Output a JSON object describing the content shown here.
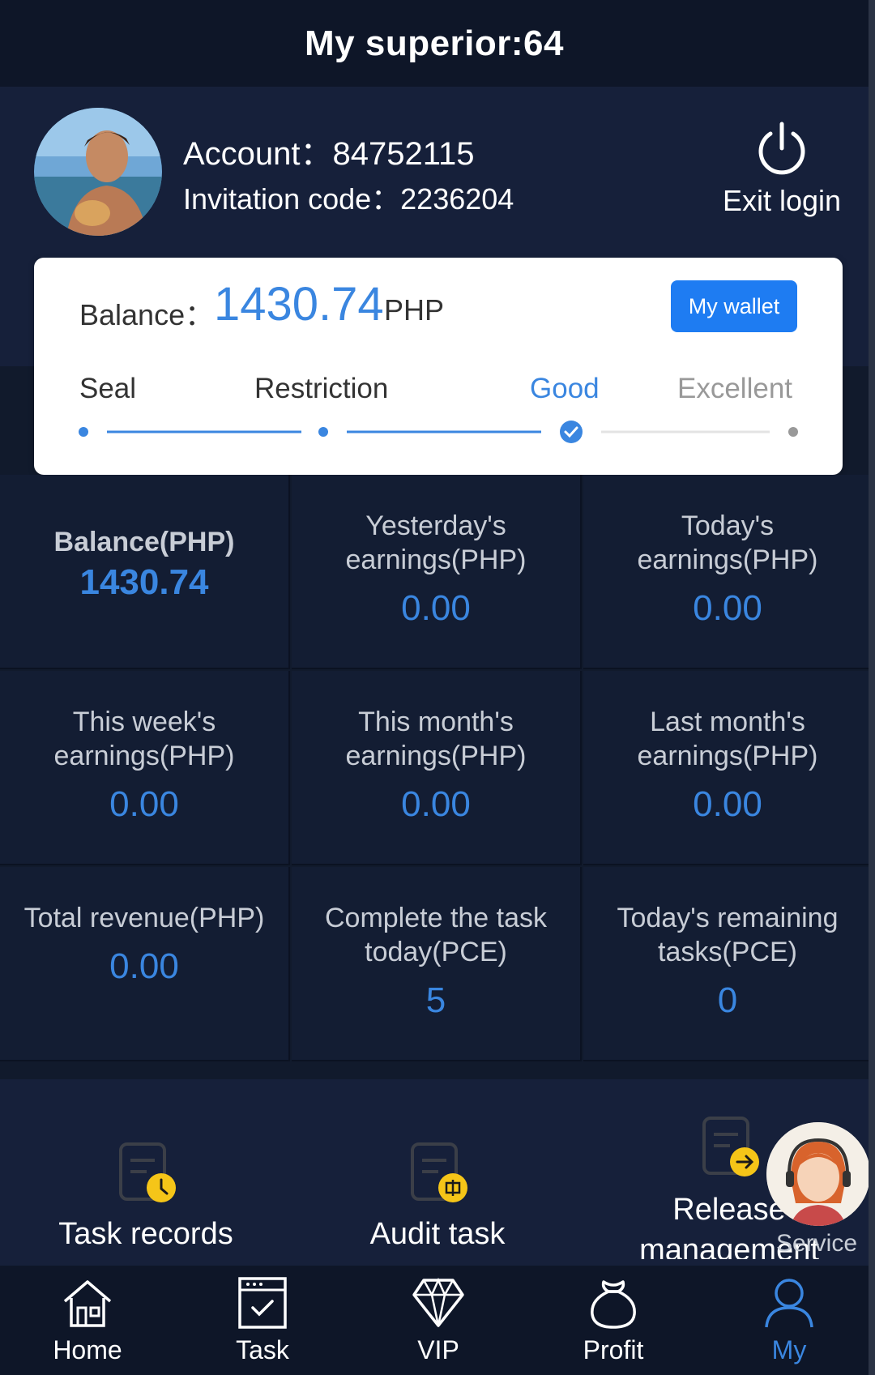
{
  "header": {
    "title": "My superior:64"
  },
  "profile": {
    "account_label": "Account：84752115",
    "invitation_label": "Invitation code：2236204",
    "exit_label": "Exit login"
  },
  "balance_card": {
    "label": "Balance：",
    "value": "1430.74",
    "unit": "PHP",
    "wallet_button": "My wallet",
    "levels": [
      "Seal",
      "Restriction",
      "Good",
      "Excellent"
    ],
    "current_level": "Good"
  },
  "stats": [
    {
      "label": "Balance(PHP)",
      "value": "1430.74"
    },
    {
      "label": "Yesterday's earnings(PHP)",
      "value": "0.00"
    },
    {
      "label": "Today's earnings(PHP)",
      "value": "0.00"
    },
    {
      "label": "This week's earnings(PHP)",
      "value": "0.00"
    },
    {
      "label": "This month's earnings(PHP)",
      "value": "0.00"
    },
    {
      "label": "Last month's earnings(PHP)",
      "value": "0.00"
    },
    {
      "label": "Total revenue(PHP)",
      "value": "0.00"
    },
    {
      "label": "Complete the task today(PCE)",
      "value": "5"
    },
    {
      "label": "Today's remaining tasks(PCE)",
      "value": "0"
    }
  ],
  "actions": [
    {
      "label": "Task records",
      "icon": "task-records-icon"
    },
    {
      "label": "Audit task",
      "icon": "audit-task-icon"
    },
    {
      "label": "Release management",
      "icon": "release-management-icon"
    }
  ],
  "service": {
    "label": "Service"
  },
  "tabbar": [
    {
      "label": "Home",
      "icon": "home-icon"
    },
    {
      "label": "Task",
      "icon": "task-icon"
    },
    {
      "label": "VIP",
      "icon": "diamond-icon"
    },
    {
      "label": "Profit",
      "icon": "money-bag-icon"
    },
    {
      "label": "My",
      "icon": "user-icon",
      "active": true
    }
  ],
  "colors": {
    "accent": "#3a86e0",
    "wallet_button": "#1e7cf2",
    "background": "#111a2c",
    "icon_yellow": "#f5c518"
  }
}
